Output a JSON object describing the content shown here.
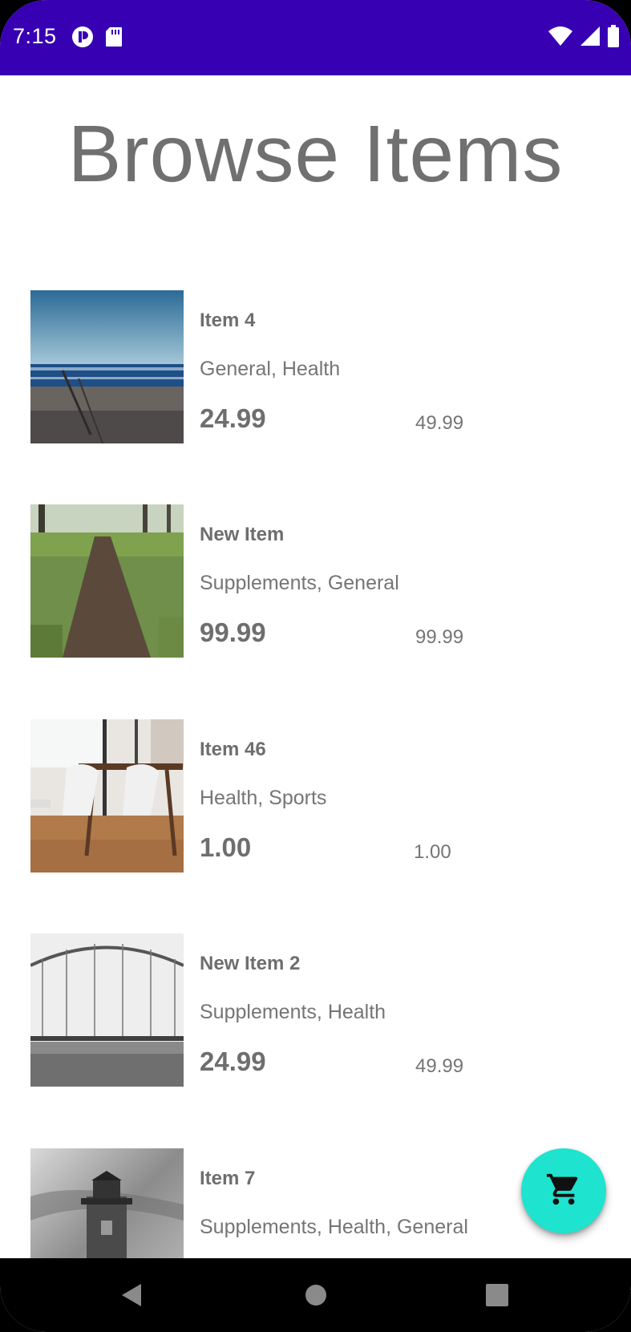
{
  "status_bar": {
    "time": "7:15",
    "color": "#3700b3",
    "icons_left": [
      "app-notification-icon",
      "sd-card-icon"
    ],
    "icons_right": [
      "wifi-icon",
      "cell-signal-icon",
      "battery-icon"
    ]
  },
  "page": {
    "title": "Browse Items"
  },
  "items": [
    {
      "name": "Item 4",
      "categories": "General, Health",
      "price": "24.99",
      "original_price": "49.99",
      "image": "beach-photo"
    },
    {
      "name": "New Item",
      "categories": "Supplements, General",
      "price": "99.99",
      "original_price": "99.99",
      "image": "forest-path-photo"
    },
    {
      "name": "Item 46",
      "categories": "Health, Sports",
      "price": "1.00",
      "original_price": "1.00",
      "image": "dining-room-photo"
    },
    {
      "name": "New Item 2",
      "categories": "Supplements, Health",
      "price": "24.99",
      "original_price": "49.99",
      "image": "bridge-photo"
    },
    {
      "name": "Item 7",
      "categories": "Supplements, Health, General",
      "price": "",
      "original_price": "",
      "image": "lighthouse-photo"
    }
  ],
  "fab": {
    "icon": "shopping-cart-icon",
    "color": "#1ee3cf"
  },
  "nav_bar": {
    "buttons": [
      "back-icon",
      "home-icon",
      "recents-icon"
    ]
  }
}
